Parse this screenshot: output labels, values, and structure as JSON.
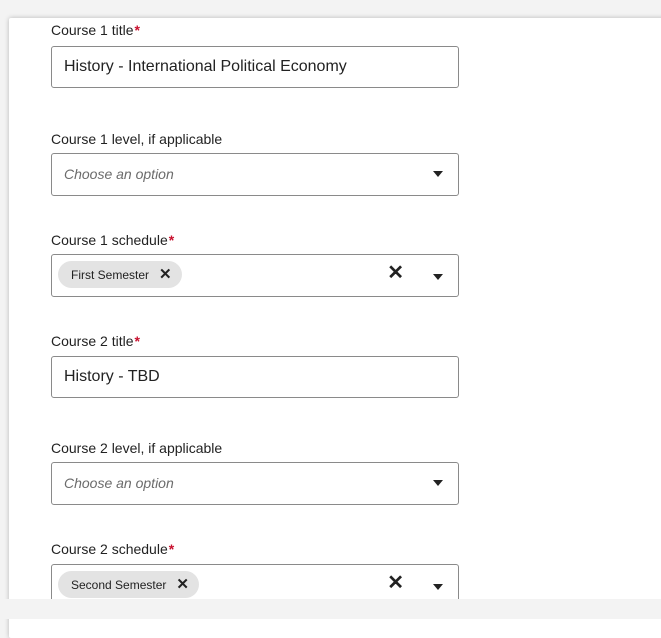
{
  "form": {
    "course1_title": {
      "label": "Course 1 title",
      "required_mark": "*",
      "value": "History - International Political Economy"
    },
    "course1_level": {
      "label": "Course 1 level, if applicable",
      "placeholder": "Choose an option"
    },
    "course1_schedule": {
      "label": "Course 1 schedule",
      "required_mark": "*",
      "tag": "First Semester",
      "tag_remove": "✕",
      "clear": "✕"
    },
    "course2_title": {
      "label": "Course 2 title",
      "required_mark": "*",
      "value": "History - TBD"
    },
    "course2_level": {
      "label": "Course 2 level, if applicable",
      "placeholder": "Choose an option"
    },
    "course2_schedule": {
      "label": "Course 2 schedule",
      "required_mark": "*",
      "tag": "Second Semester",
      "tag_remove": "✕",
      "clear": "✕"
    }
  },
  "colors": {
    "required": "#c8102e",
    "tag_background": "#e3e3e3",
    "border": "#8a8a8a"
  }
}
